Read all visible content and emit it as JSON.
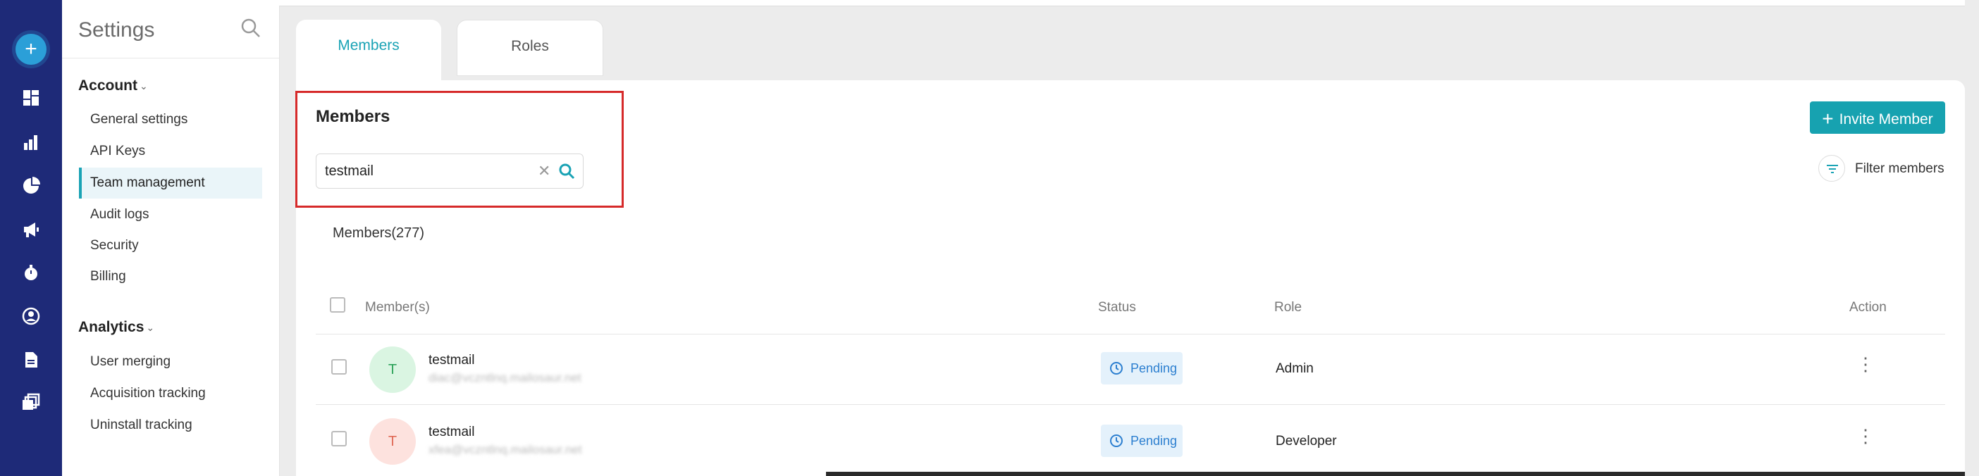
{
  "sidebar": {
    "title": "Settings",
    "sections": [
      {
        "label": "Account",
        "items": [
          "General settings",
          "API Keys",
          "Team management",
          "Audit logs",
          "Security",
          "Billing"
        ]
      },
      {
        "label": "Analytics",
        "items": [
          "User merging",
          "Acquisition tracking",
          "Uninstall tracking"
        ]
      }
    ],
    "active_item": "Team management"
  },
  "tabs": {
    "members": "Members",
    "roles": "Roles"
  },
  "members_panel": {
    "heading": "Members",
    "search_value": "testmail",
    "invite_label": "Invite Member",
    "filter_label": "Filter members",
    "count_label": "Members(277)"
  },
  "table": {
    "headers": {
      "member": "Member(s)",
      "status": "Status",
      "role": "Role",
      "action": "Action"
    },
    "rows": [
      {
        "initial": "T",
        "name": "testmail",
        "email": "diac@vczntlnq.mailosaur.net",
        "status": "Pending",
        "role": "Admin"
      },
      {
        "initial": "T",
        "name": "testmail",
        "email": "xfea@vczntlnq.mailosaur.net",
        "status": "Pending",
        "role": "Developer"
      }
    ]
  },
  "colors": {
    "rail": "#1e2a78",
    "accent": "#1aa3b5",
    "highlight_box": "#d62a2a",
    "pending_badge_bg": "#e4f1fb"
  }
}
